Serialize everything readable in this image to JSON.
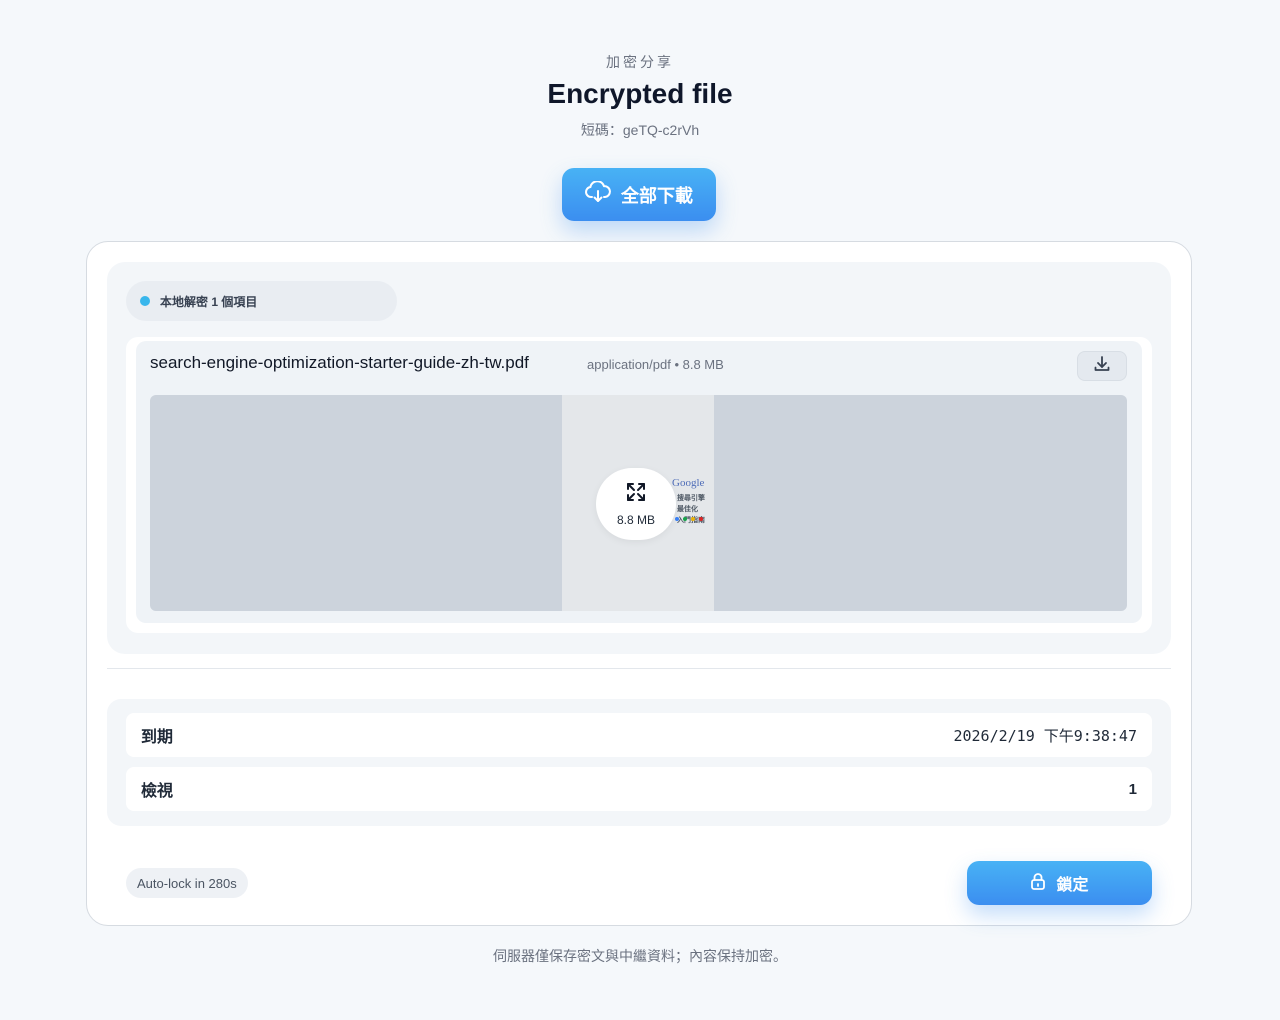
{
  "header": {
    "eyebrow": "加密分享",
    "title": "Encrypted file",
    "shortcode": "短碼：geTQ-c2rVh",
    "download_all_label": "全部下載"
  },
  "files": {
    "status": "本地解密 1 個項目",
    "items": [
      {
        "name": "search-engine-optimization-starter-guide-zh-tw.pdf",
        "meta": "application/pdf • 8.8 MB",
        "preview": {
          "size_label": "8.8 MB",
          "brand": "Google",
          "lines": [
            "搜尋引擎最佳化",
            "入門指南"
          ]
        }
      }
    ]
  },
  "details": {
    "expiry_label": "到期",
    "expiry_value": "2026/2/19 下午9:38:47",
    "views_label": "檢視",
    "views_value": "1"
  },
  "actions": {
    "autolock": "Auto-lock in 280s",
    "lock_label": "鎖定"
  },
  "footer": "伺服器僅保存密文與中繼資料；內容保持加密。",
  "colors": {
    "accent": "#3b8ef0",
    "status_dot": "#38b6ec",
    "brand_dots": [
      "#3b82f6",
      "#16a34a",
      "#eab308",
      "#dc2626"
    ]
  },
  "icons": {
    "download_all": "cloud-download-icon",
    "file_download": "download-icon",
    "expand": "expand-icon",
    "lock": "lock-icon"
  }
}
